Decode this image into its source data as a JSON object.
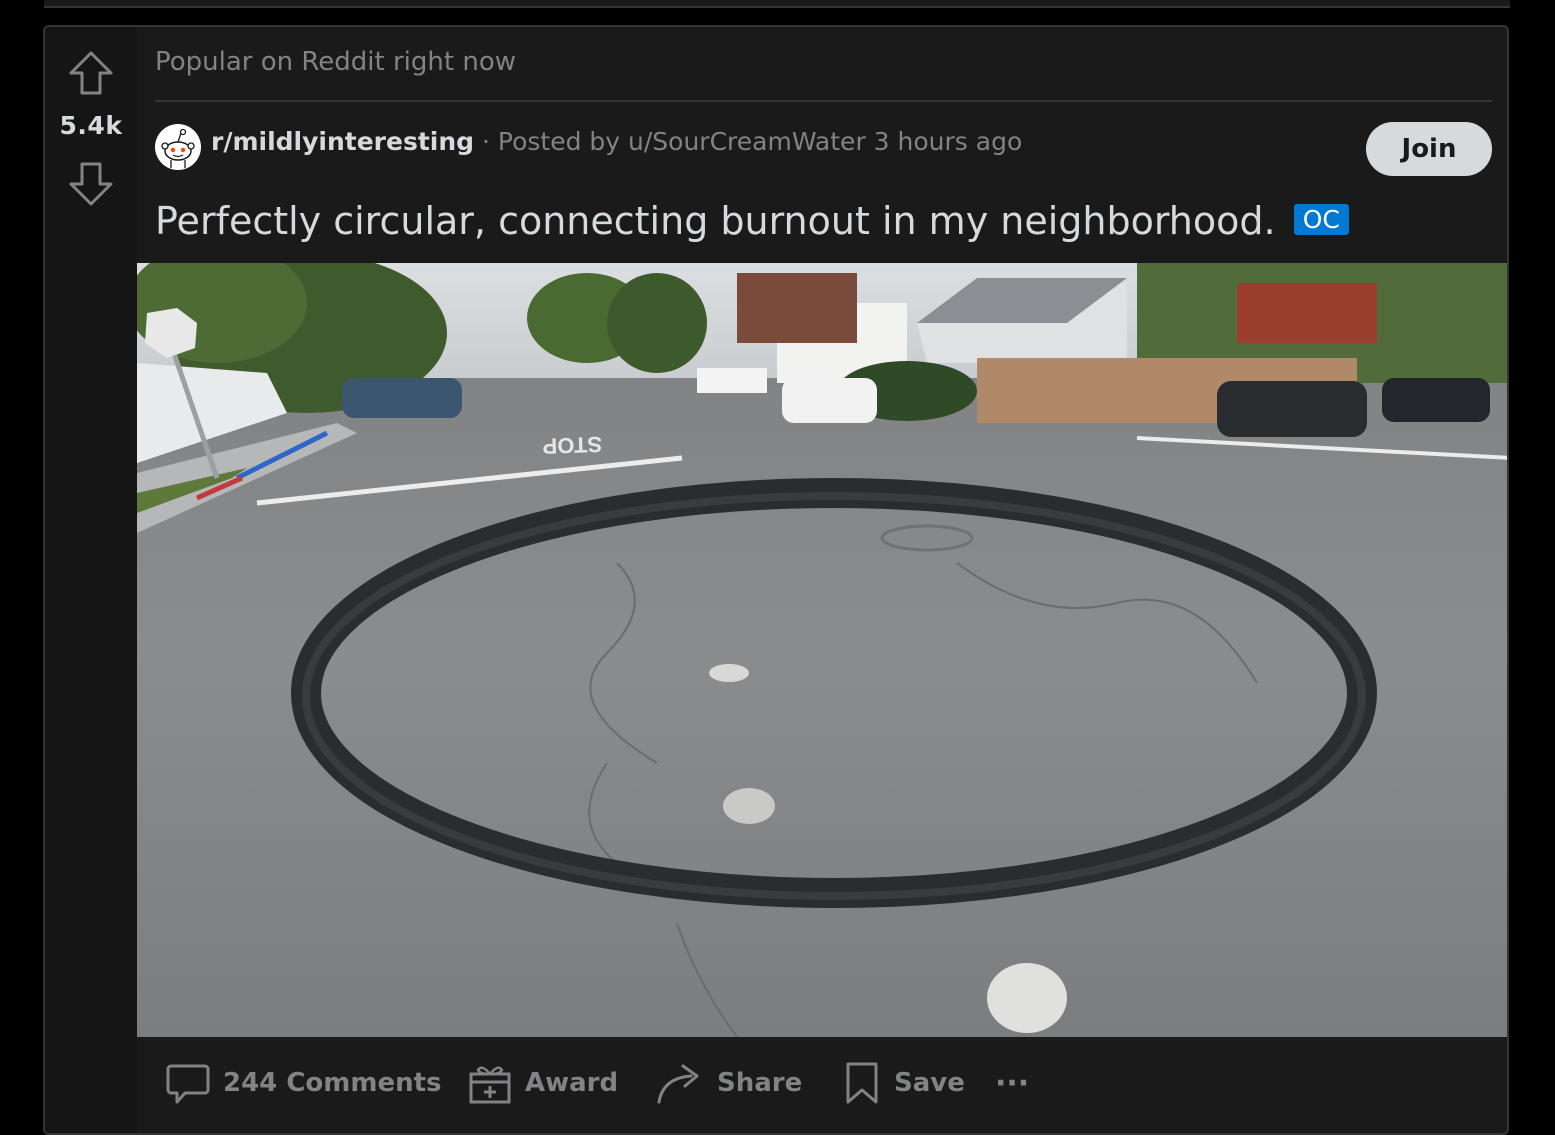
{
  "header": {
    "popular_label": "Popular on Reddit right now"
  },
  "vote": {
    "score": "5.4k"
  },
  "post": {
    "subreddit": "r/mildlyinteresting",
    "separator": " · ",
    "posted_by": "Posted by u/SourCreamWater",
    "time": "3 hours ago",
    "join_label": "Join",
    "title": "Perfectly circular, connecting burnout in my neighborhood.",
    "flair": "OC",
    "image_road_text": "STOP"
  },
  "actions": {
    "comments": "244 Comments",
    "award": "Award",
    "share": "Share",
    "save": "Save",
    "more": "···"
  },
  "colors": {
    "card_bg": "#1a1a1b",
    "text_primary": "#d7dadc",
    "text_muted": "#818384",
    "flair_blue": "#0079d3"
  },
  "icons": [
    "upvote-icon",
    "downvote-icon",
    "comment-icon",
    "gift-icon",
    "share-arrow-icon",
    "bookmark-icon",
    "more-dots-icon"
  ]
}
